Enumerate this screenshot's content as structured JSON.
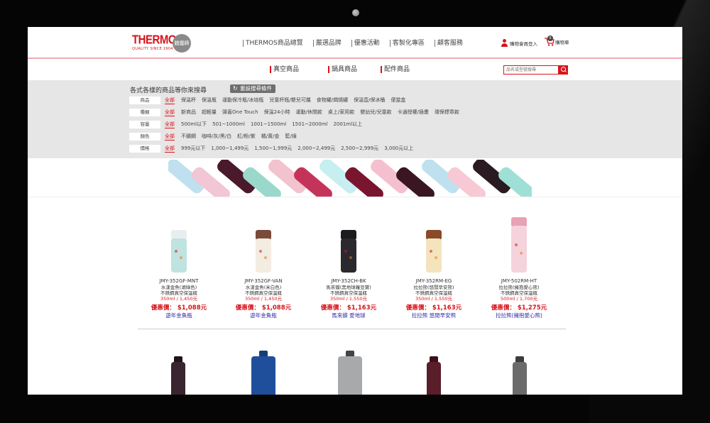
{
  "header": {
    "logo": "THERMOS.",
    "logo_sub": "QUALITY SINCE 1904",
    "badge": "膳魔師",
    "nav": [
      "THERMOS商品總覽",
      "嚴選品牌",
      "優惠活動",
      "客製化專區",
      "顧客服務"
    ],
    "account": "購物會員登入",
    "cart": "購物車",
    "cart_count": "0"
  },
  "subnav": {
    "items": [
      "真空商品",
      "鍋具商品",
      "配件商品"
    ],
    "search_placeholder": "品名或型號搜尋"
  },
  "filters": {
    "title": "各式各樣的商品等你來搜尋",
    "reset": "重設搜尋條件",
    "rows": [
      {
        "label": "商品",
        "options": [
          "全部",
          "保溫杯",
          "保溫瓶",
          "運動保冷瓶/冰焙瓶",
          "兒童杯瓶/嬰兒可攜",
          "食物罐/燜燒罐",
          "保溫壺/保冰桶",
          "便當盒"
        ]
      },
      {
        "label": "種類",
        "options": [
          "全部",
          "新商品",
          "超輕量",
          "彈蓋One Touch",
          "保溫24小時",
          "運動/休閒款",
          "桌上/家用款",
          "嬰幼兒/兒童款",
          "卡通授權/插畫",
          "環保標章款"
        ]
      },
      {
        "label": "容量",
        "options": [
          "全部",
          "500ml以下",
          "501~1000ml",
          "1001~1500ml",
          "1501~2000ml",
          "2001ml以上"
        ]
      },
      {
        "label": "顏色",
        "options": [
          "全部",
          "不鏽鋼",
          "咖啡/灰/黑/白",
          "紅/粉/紫",
          "橘/黃/金",
          "藍/綠"
        ]
      },
      {
        "label": "價格",
        "options": [
          "全部",
          "999元以下",
          "1,000~1,499元",
          "1,500~1,999元",
          "2,000~2,499元",
          "2,500~2,999元",
          "3,000元以上"
        ]
      }
    ]
  },
  "products": [
    {
      "model": "JMY-352GF-MNT",
      "name": "水漾金魚(湖綠色)",
      "type": "不銹鋼真空保溫瓶",
      "spec": "350ml / 1,450元",
      "price": "優惠價： $1,088元",
      "series": "遊年金魚瓶",
      "color": "#bfe3e0",
      "cap": "#e8eef0"
    },
    {
      "model": "JMY-352GF-VAN",
      "name": "水漾金魚(米白色)",
      "type": "不銹鋼真空保溫瓶",
      "spec": "350ml / 1,450元",
      "price": "優惠價： $1,088元",
      "series": "遊年金魚瓶",
      "color": "#f3ece0",
      "cap": "#7a4b3a"
    },
    {
      "model": "JMY-352CH-BK",
      "name": "馬來貘(黑地球蘿豆寶)",
      "type": "不銹鋼真空保溫瓶",
      "spec": "350ml / 1,550元",
      "price": "優惠價： $1,163元",
      "series": "馬來貘 愛地球",
      "color": "#2a2a2e",
      "cap": "#1c1c1f"
    },
    {
      "model": "JMY-352RM-EG",
      "name": "拉拉熊(悠閒早安熊)",
      "type": "不銹鋼真空保溫瓶",
      "spec": "350ml / 1,550元",
      "price": "優惠價： $1,163元",
      "series": "拉拉熊 悠閒早安熊",
      "color": "#f4e4be",
      "cap": "#8a4a2a"
    },
    {
      "model": "JMY-502RM-HT",
      "name": "拉拉熊(擁抱愛心熊)",
      "type": "不銹鋼真空保溫瓶",
      "spec": "500ml / 1,700元",
      "price": "優惠價： $1,275元",
      "series": "拉拉熊(擁抱愛心熊)",
      "color": "#f5d3dc",
      "cap": "#e9a1b4"
    }
  ],
  "row2": [
    {
      "color": "#3a2430",
      "cap": "#201418"
    },
    {
      "color": "#1f4f9a",
      "cap": "#173c78"
    },
    {
      "color": "#a7a9ab",
      "cap": "#444444"
    },
    {
      "color": "#5a1d2a",
      "cap": "#3a1019"
    },
    {
      "color": "#6b6b6b",
      "cap": "#3c3c3c"
    }
  ],
  "banner_colors": [
    "#bfe0ef",
    "#f2c6d4",
    "#4a1a2c",
    "#9ad8cc",
    "#f3c2cf",
    "#c4345a",
    "#c7eef0",
    "#7a1530",
    "#f4c0cf",
    "#3a1522",
    "#bfe0ef",
    "#f7c9d5",
    "#2a1a22",
    "#9fe0d6"
  ]
}
